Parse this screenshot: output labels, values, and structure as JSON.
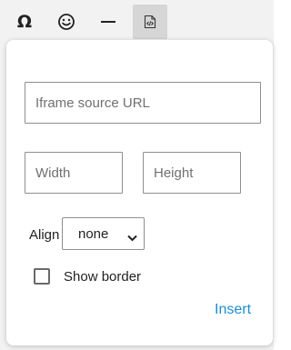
{
  "toolbar": {
    "buttons": [
      {
        "icon": "omega-icon",
        "glyph": "Ω"
      },
      {
        "icon": "smiley-icon"
      },
      {
        "icon": "horizontal-rule-icon"
      },
      {
        "icon": "iframe-embed-icon",
        "active": true
      }
    ]
  },
  "form": {
    "url_placeholder": "Iframe source URL",
    "width_placeholder": "Width",
    "height_placeholder": "Height",
    "align_label": "Align",
    "align_value": "none",
    "show_border_label": "Show border",
    "show_border_checked": false,
    "insert_label": "Insert"
  },
  "colors": {
    "accent": "#1c8cd0",
    "active_button_bg": "#d6d6d6"
  }
}
